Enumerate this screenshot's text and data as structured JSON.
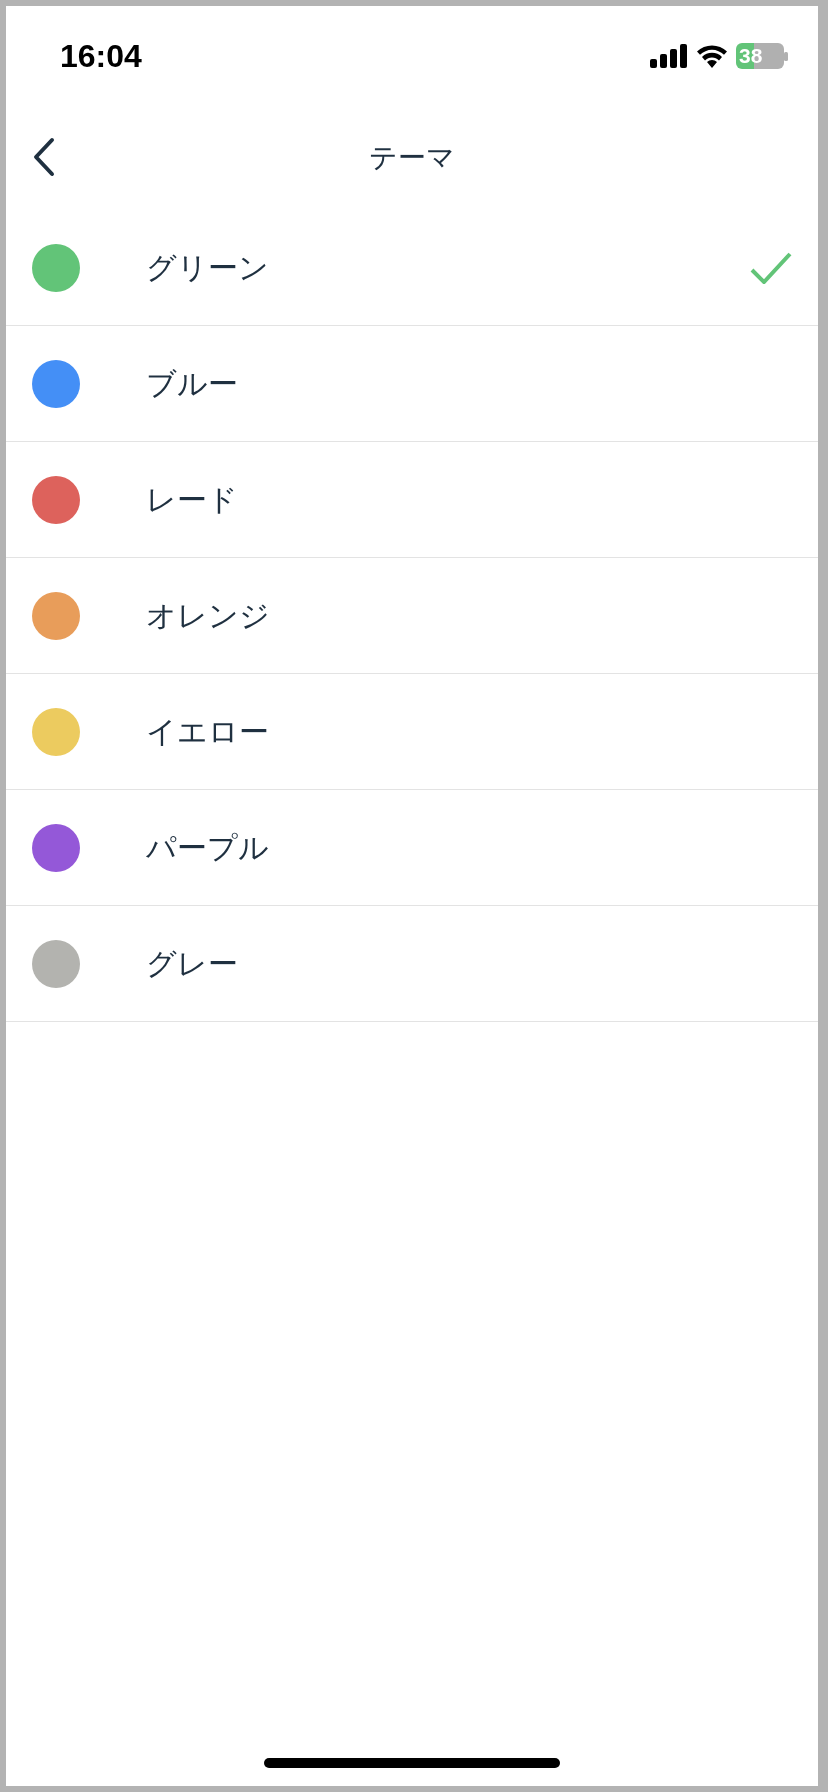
{
  "status_bar": {
    "time": "16:04",
    "battery": "38"
  },
  "nav": {
    "title": "テーマ"
  },
  "themes": [
    {
      "label": "グリーン",
      "color": "#62c478",
      "selected": true
    },
    {
      "label": "ブルー",
      "color": "#448ff6",
      "selected": false
    },
    {
      "label": "レード",
      "color": "#dd625c",
      "selected": false
    },
    {
      "label": "オレンジ",
      "color": "#e89d5a",
      "selected": false
    },
    {
      "label": "イエロー",
      "color": "#eccb5f",
      "selected": false
    },
    {
      "label": "パープル",
      "color": "#9458d8",
      "selected": false
    },
    {
      "label": "グレー",
      "color": "#b3b3af",
      "selected": false
    }
  ]
}
